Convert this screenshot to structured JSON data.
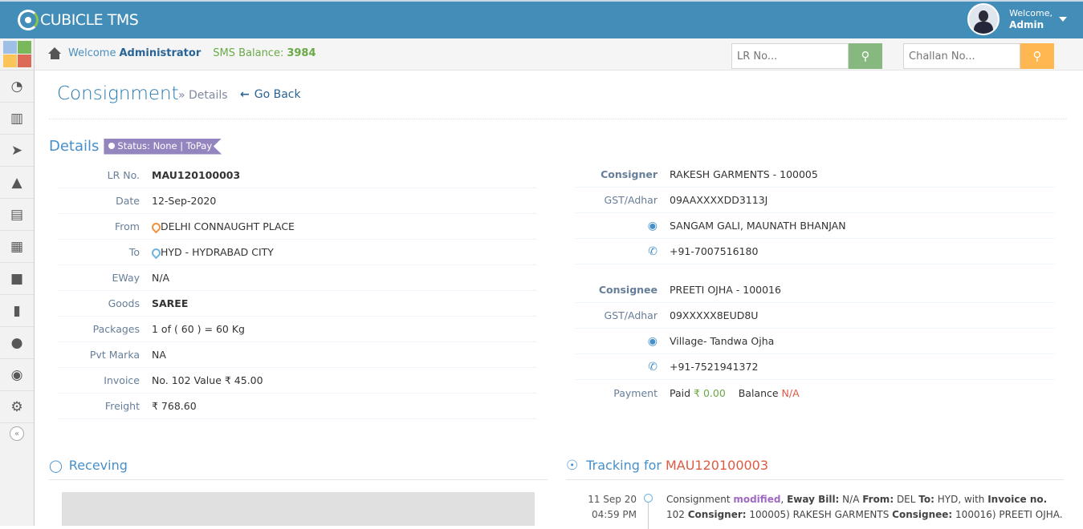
{
  "app": {
    "brand": "CUBICLE TMS"
  },
  "user": {
    "welcome": "Welcome,",
    "name": "Admin"
  },
  "sidebar": {
    "tile_colors": [
      "#9fc0e6",
      "#7ab85c",
      "#fbc45b",
      "#dd6a57"
    ],
    "items": [
      {
        "icon": "dashboard-icon",
        "glyph": "◔"
      },
      {
        "icon": "bar-chart-icon",
        "glyph": "▥"
      },
      {
        "icon": "paper-plane-icon",
        "glyph": "➤"
      },
      {
        "icon": "road-icon",
        "glyph": "▲"
      },
      {
        "icon": "book-icon",
        "glyph": "▤"
      },
      {
        "icon": "building-icon",
        "glyph": "▦"
      },
      {
        "icon": "truck-icon",
        "glyph": "■"
      },
      {
        "icon": "ledger-icon",
        "glyph": "▮"
      },
      {
        "icon": "users-icon",
        "glyph": "●"
      },
      {
        "icon": "eye-icon",
        "glyph": "◉"
      },
      {
        "icon": "cogs-icon",
        "glyph": "⚙"
      }
    ],
    "collapse_glyph": "«"
  },
  "breadcrumbs": {
    "welcome": "Welcome",
    "admin": "Administrator",
    "sms_label": "SMS Balance:",
    "sms_value": "3984"
  },
  "search": {
    "lr_placeholder": "LR No...",
    "challan_placeholder": "Challan No...",
    "lr_btn_color": "#87b87f",
    "challan_btn_color": "#ffb752"
  },
  "page": {
    "title": "Consignment",
    "subtitle": "» Details",
    "back": "Go Back"
  },
  "details": {
    "title": "Details",
    "status": "Status: None | ToPay",
    "left": [
      {
        "label": "LR No.",
        "value": "MAU120100003",
        "strong": true
      },
      {
        "label": "Date",
        "value": "12-Sep-2020"
      },
      {
        "label": "From",
        "value": "DELHI CONNAUGHT PLACE",
        "pin": "orange"
      },
      {
        "label": "To",
        "value": "HYD - HYDRABAD CITY",
        "pin": "blue"
      },
      {
        "label": "EWay",
        "value": "N/A"
      },
      {
        "label": "Goods",
        "value": "SAREE",
        "strong": true
      },
      {
        "label": "Packages",
        "value": "1 of ( 60 ) = 60 Kg"
      },
      {
        "label": "Pvt Marka",
        "value": "NA"
      },
      {
        "label": "Invoice",
        "value": "No. 102  Value ₹ 45.00"
      },
      {
        "label": "Freight",
        "value": "₹ 768.60"
      }
    ],
    "consigner": {
      "label": "Consigner",
      "value": "RAKESH GARMENTS - 100005",
      "gst_label": "GST/Adhar",
      "gst": "09AAXXXXDD3113J",
      "address": "SANGAM GALI, MAUNATH BHANJAN",
      "phone": "+91-7007516180"
    },
    "consignee": {
      "label": "Consignee",
      "value": "PREETI OJHA - 100016",
      "gst_label": "GST/Adhar",
      "gst": "09XXXXX8EUD8U",
      "address": "Village- Tandwa Ojha",
      "phone": "+91-7521941372"
    },
    "payment": {
      "label": "Payment",
      "paid_label": "Paid",
      "paid": "₹ 0.00",
      "balance_label": "Balance",
      "balance": "N/A"
    }
  },
  "receiving": {
    "title": "Receving"
  },
  "tracking": {
    "title": "Tracking for",
    "lr": "MAU120100003",
    "entry": {
      "date": "11 Sep 20",
      "time": "04:59 PM",
      "t1": "Consignment ",
      "action": "modified",
      "t2": ", ",
      "k_eway": "Eway Bill:",
      "v_eway": " N/A ",
      "k_from": "From:",
      "v_from": " DEL ",
      "k_to": "To:",
      "v_to": " HYD, with ",
      "k_invoice": "Invoice no.",
      "v_invoice": " 102 ",
      "k_consigner": "Consigner:",
      "v_consigner": " 100005) RAKESH GARMENTS ",
      "k_consignee": "Consignee:",
      "v_consignee": " 100016) PREETI OJHA."
    }
  }
}
